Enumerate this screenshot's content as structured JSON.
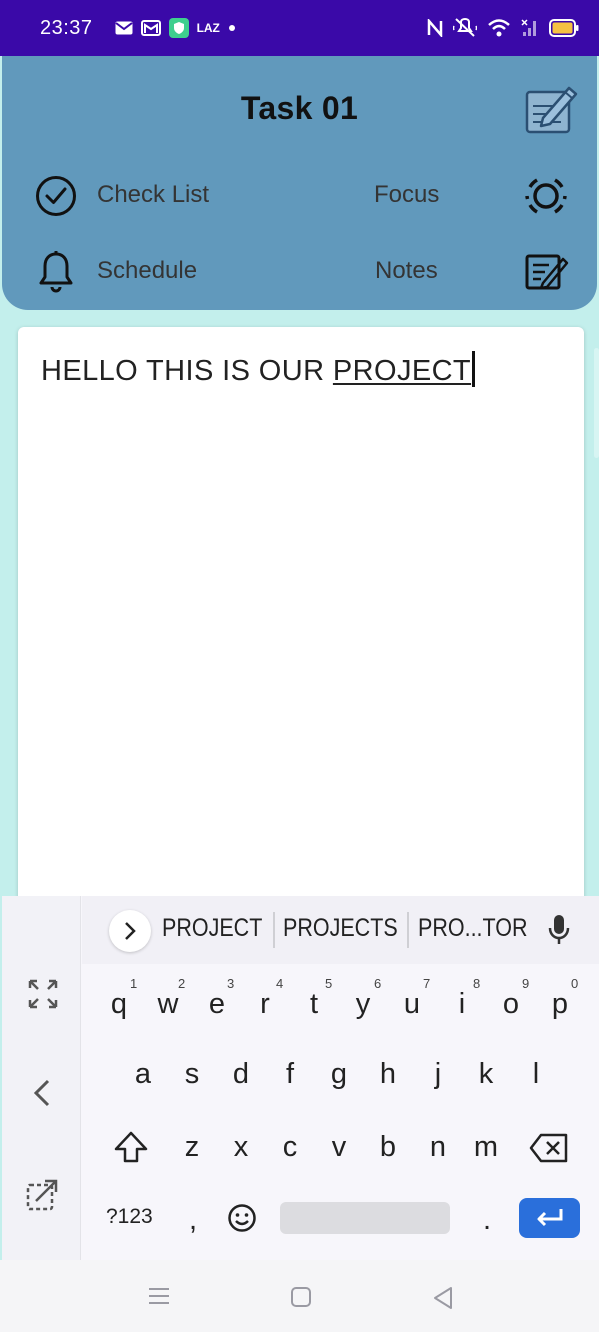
{
  "status_bar": {
    "time": "23:37",
    "carrier": "LAZ",
    "icons": [
      "mail-icon",
      "gmail-icon",
      "shield-icon",
      "dot-icon",
      "nfc-icon",
      "mute-icon",
      "wifi-icon",
      "signal-icon",
      "battery-icon"
    ]
  },
  "header": {
    "title": "Task 01",
    "edit_icon": "edit-note-icon",
    "menu": {
      "check_list": "Check List",
      "focus": "Focus",
      "schedule": "Schedule",
      "notes": "Notes"
    }
  },
  "note": {
    "text_before": "HELLO THIS IS OUR ",
    "text_current_word": "PROJECT"
  },
  "keyboard": {
    "suggestions": [
      "PROJECT",
      "PROJECTS",
      "PRO...TOR"
    ],
    "row1": [
      "q",
      "w",
      "e",
      "r",
      "t",
      "y",
      "u",
      "i",
      "o",
      "p"
    ],
    "row1_nums": [
      "1",
      "2",
      "3",
      "4",
      "5",
      "6",
      "7",
      "8",
      "9",
      "0"
    ],
    "row2": [
      "a",
      "s",
      "d",
      "f",
      "g",
      "h",
      "j",
      "k",
      "l"
    ],
    "row3": [
      "z",
      "x",
      "c",
      "v",
      "b",
      "n",
      "m"
    ],
    "symbols_key": "?123",
    "comma": ",",
    "period": "."
  },
  "colors": {
    "status_bar": "#3a09a8",
    "header": "#6199bc",
    "background": "#c3efec",
    "enter": "#2a6fdb"
  }
}
